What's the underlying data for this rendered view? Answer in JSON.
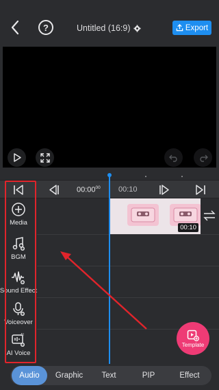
{
  "header": {
    "title": "Untitled (16:9)",
    "export_label": "Export",
    "icons": {
      "back": "chevron-left-icon",
      "help": "help-icon",
      "settings": "gear-icon",
      "export": "upload-icon"
    }
  },
  "preview": {
    "icons": [
      "play-icon",
      "fullscreen-icon",
      "undo-icon",
      "redo-icon"
    ]
  },
  "transport": {
    "current_time": "00:00",
    "current_time_frames": "00",
    "next_time": "00:10",
    "icons": [
      "skip-to-start-icon",
      "previous-frame-icon",
      "next-frame-icon",
      "skip-to-end-icon"
    ]
  },
  "tools": [
    {
      "label": "Media",
      "icon": "add-circle-icon"
    },
    {
      "label": "BGM",
      "icon": "music-note-icon"
    },
    {
      "label": "Sound Effect",
      "icon": "sound-wave-icon"
    },
    {
      "label": "Voiceover",
      "icon": "microphone-icon"
    },
    {
      "label": "AI Voice",
      "icon": "ai-voice-icon"
    }
  ],
  "clip": {
    "duration": "00:10"
  },
  "template_fab": {
    "label": "Template"
  },
  "tabs": [
    {
      "label": "Audio",
      "active": true
    },
    {
      "label": "Graphic",
      "active": false
    },
    {
      "label": "Text",
      "active": false
    },
    {
      "label": "PIP",
      "active": false
    },
    {
      "label": "Effect",
      "active": false
    }
  ],
  "colors": {
    "accent": "#1e8ef0",
    "annotation": "#e1242b",
    "fab": "#ee3b75",
    "active_tab": "#5a93d8"
  }
}
